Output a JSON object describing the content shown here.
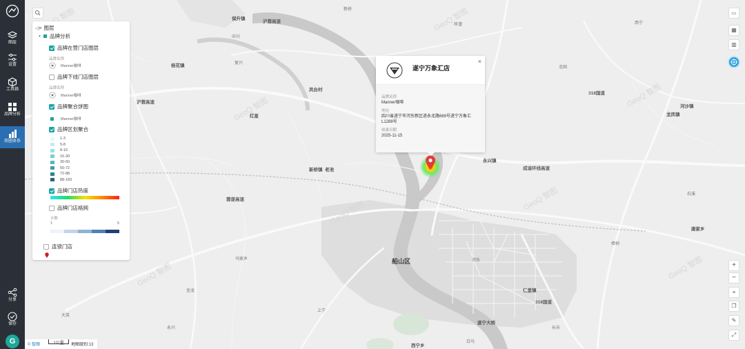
{
  "sidebar": {
    "items": [
      {
        "label": "图层",
        "icon": "layers-icon"
      },
      {
        "label": "设置",
        "icon": "sliders-icon"
      },
      {
        "label": "工具箱",
        "icon": "cube-icon"
      },
      {
        "label": "品牌分析",
        "icon": "grid-icon"
      },
      {
        "label": "商圈体系",
        "icon": "building-icon"
      }
    ],
    "bottom": [
      {
        "label": "分享",
        "icon": "share-icon"
      },
      {
        "label": "保存",
        "icon": "check-circle-icon"
      }
    ],
    "avatar": "G"
  },
  "layer_panel": {
    "title": "图层",
    "group": "品牌分析",
    "items": {
      "stores_on": "品牌在营门店图层",
      "brand_key": "品牌名称",
      "brand_name": "Manner咖啡",
      "stores_off": "品牌下线门店图层",
      "brand_key2": "品牌名称",
      "brand_name2": "Manner咖啡",
      "pie": "品牌聚合饼图",
      "pie_brand": "Manner咖啡",
      "district": "品牌区划聚合",
      "heat": "品牌门店热度",
      "grid": "品牌门店格网",
      "count_label": "计数",
      "count_min": "1",
      "count_max": "5",
      "linked": "连锁门店"
    },
    "district_ranges": [
      "1-3",
      "5-8",
      "8-16",
      "16-30",
      "30-50",
      "50-72",
      "72-88",
      "88-183"
    ]
  },
  "popup": {
    "title": "遂宁万象汇店",
    "close": "×",
    "fields": [
      {
        "key": "品牌名称",
        "value": "Manner咖啡"
      },
      {
        "key": "地址",
        "value": "四川省遂宁市河东新区遂永北路669号遂宁万象汇L1288号"
      },
      {
        "key": "收录日期",
        "value": "2025-11-15"
      }
    ]
  },
  "map": {
    "labels": {
      "county": "船山区",
      "roads": [
        "沪蓉高速",
        "318国道",
        "成渝环线高速",
        "蓉遂高速",
        "沪蓉高速",
        "318国道"
      ],
      "places": [
        "保升镇",
        "桂花镇",
        "新桥镇",
        "老池",
        "永兴镇",
        "红星",
        "凤台村",
        "河沙镇",
        "龙凤镇",
        "仁里镇",
        "唐家乡",
        "遂宁大桥",
        "西宁乡",
        "马家乡",
        "大英",
        "上宁",
        "永兴",
        "梓潼",
        "西宁",
        "北固",
        "河东",
        "长乐",
        "樟树",
        "新桥",
        "白马",
        "中兴",
        "复兴",
        "金龙",
        "石溪"
      ]
    },
    "zoom_label": "地图级别:13",
    "scale": "1公里",
    "attribution": "© 智图",
    "watermark": "GeoQ 智图"
  },
  "right_tools": {
    "zoom_in": "+",
    "zoom_out": "−"
  }
}
